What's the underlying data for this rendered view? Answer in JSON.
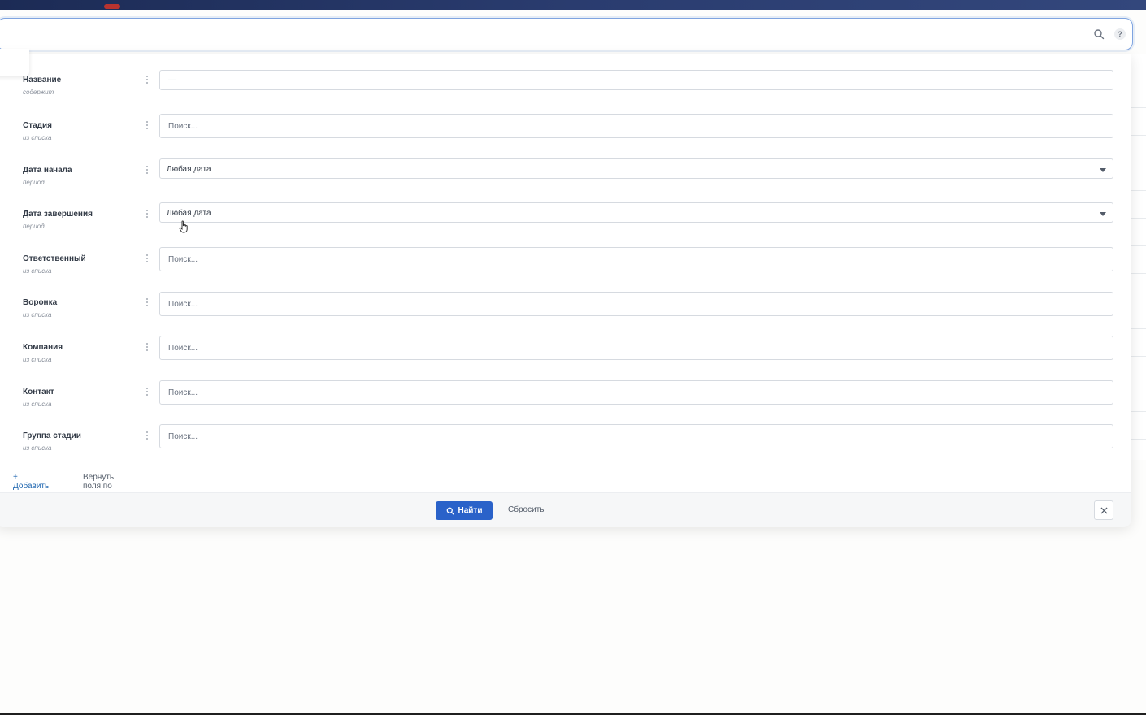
{
  "search": {
    "placeholder": "",
    "search_icon": "search-icon",
    "help_label": "?"
  },
  "filters": [
    {
      "label": "Название",
      "type": "содержит",
      "kind": "text",
      "value": "—",
      "placeholder": ""
    },
    {
      "label": "Стадия",
      "type": "из списка",
      "kind": "search",
      "value": "",
      "placeholder": "Поиск..."
    },
    {
      "label": "Дата начала",
      "type": "период",
      "kind": "select",
      "value": "Любая дата"
    },
    {
      "label": "Дата завершения",
      "type": "период",
      "kind": "select",
      "value": "Любая дата"
    },
    {
      "label": "Ответственный",
      "type": "из списка",
      "kind": "search",
      "value": "",
      "placeholder": "Поиск..."
    },
    {
      "label": "Воронка",
      "type": "из списка",
      "kind": "search",
      "value": "",
      "placeholder": "Поиск..."
    },
    {
      "label": "Компания",
      "type": "из списка",
      "kind": "search",
      "value": "",
      "placeholder": "Поиск..."
    },
    {
      "label": "Контакт",
      "type": "из списка",
      "kind": "search",
      "value": "",
      "placeholder": "Поиск..."
    },
    {
      "label": "Группа стадии",
      "type": "из списка",
      "kind": "search",
      "value": "",
      "placeholder": "Поиск..."
    }
  ],
  "links": {
    "add_field": "+ Добавить поле",
    "restore_defaults": "Вернуть поля по умолчанию"
  },
  "footer": {
    "find_label": "Найти",
    "reset_label": "Сбросить"
  },
  "colors": {
    "accent": "#2a62c9",
    "link": "#2067b0",
    "searchbar_border": "#7fa4e0"
  }
}
